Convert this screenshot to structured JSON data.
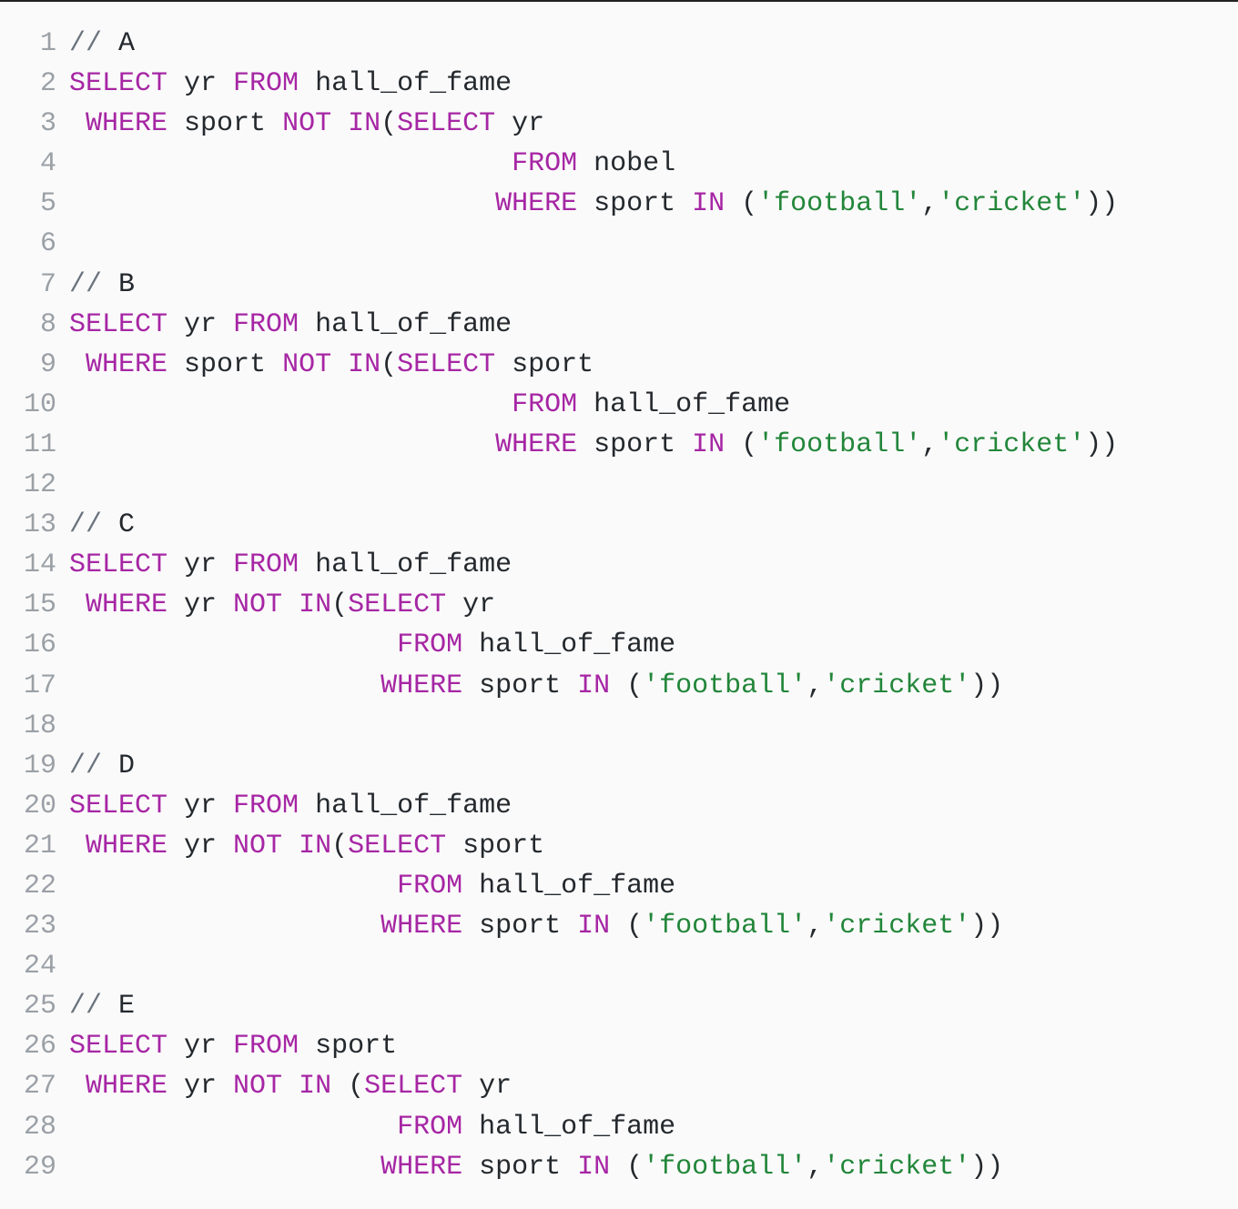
{
  "code": {
    "lines": [
      {
        "n": "1",
        "tokens": [
          {
            "c": "cm",
            "t": "// "
          },
          {
            "c": "id",
            "t": "A"
          }
        ]
      },
      {
        "n": "2",
        "tokens": [
          {
            "c": "kw",
            "t": "SELECT"
          },
          {
            "c": "id",
            "t": " yr "
          },
          {
            "c": "kw",
            "t": "FROM"
          },
          {
            "c": "id",
            "t": " hall_of_fame"
          }
        ]
      },
      {
        "n": "3",
        "tokens": [
          {
            "c": "id",
            "t": " "
          },
          {
            "c": "kw",
            "t": "WHERE"
          },
          {
            "c": "id",
            "t": " sport "
          },
          {
            "c": "kw",
            "t": "NOT"
          },
          {
            "c": "id",
            "t": " "
          },
          {
            "c": "kw",
            "t": "IN"
          },
          {
            "c": "pn",
            "t": "("
          },
          {
            "c": "kw",
            "t": "SELECT"
          },
          {
            "c": "id",
            "t": " yr"
          }
        ]
      },
      {
        "n": "4",
        "tokens": [
          {
            "c": "id",
            "t": "                           "
          },
          {
            "c": "kw",
            "t": "FROM"
          },
          {
            "c": "id",
            "t": " nobel"
          }
        ]
      },
      {
        "n": "5",
        "tokens": [
          {
            "c": "id",
            "t": "                          "
          },
          {
            "c": "kw",
            "t": "WHERE"
          },
          {
            "c": "id",
            "t": " sport "
          },
          {
            "c": "kw",
            "t": "IN"
          },
          {
            "c": "id",
            "t": " "
          },
          {
            "c": "pn",
            "t": "("
          },
          {
            "c": "str",
            "t": "'football'"
          },
          {
            "c": "pn",
            "t": ","
          },
          {
            "c": "str",
            "t": "'cricket'"
          },
          {
            "c": "pn",
            "t": "))"
          }
        ]
      },
      {
        "n": "6",
        "tokens": []
      },
      {
        "n": "7",
        "tokens": [
          {
            "c": "cm",
            "t": "// "
          },
          {
            "c": "id",
            "t": "B"
          }
        ]
      },
      {
        "n": "8",
        "tokens": [
          {
            "c": "kw",
            "t": "SELECT"
          },
          {
            "c": "id",
            "t": " yr "
          },
          {
            "c": "kw",
            "t": "FROM"
          },
          {
            "c": "id",
            "t": " hall_of_fame"
          }
        ]
      },
      {
        "n": "9",
        "tokens": [
          {
            "c": "id",
            "t": " "
          },
          {
            "c": "kw",
            "t": "WHERE"
          },
          {
            "c": "id",
            "t": " sport "
          },
          {
            "c": "kw",
            "t": "NOT"
          },
          {
            "c": "id",
            "t": " "
          },
          {
            "c": "kw",
            "t": "IN"
          },
          {
            "c": "pn",
            "t": "("
          },
          {
            "c": "kw",
            "t": "SELECT"
          },
          {
            "c": "id",
            "t": " sport"
          }
        ]
      },
      {
        "n": "10",
        "tokens": [
          {
            "c": "id",
            "t": "                           "
          },
          {
            "c": "kw",
            "t": "FROM"
          },
          {
            "c": "id",
            "t": " hall_of_fame"
          }
        ]
      },
      {
        "n": "11",
        "tokens": [
          {
            "c": "id",
            "t": "                          "
          },
          {
            "c": "kw",
            "t": "WHERE"
          },
          {
            "c": "id",
            "t": " sport "
          },
          {
            "c": "kw",
            "t": "IN"
          },
          {
            "c": "id",
            "t": " "
          },
          {
            "c": "pn",
            "t": "("
          },
          {
            "c": "str",
            "t": "'football'"
          },
          {
            "c": "pn",
            "t": ","
          },
          {
            "c": "str",
            "t": "'cricket'"
          },
          {
            "c": "pn",
            "t": "))"
          }
        ]
      },
      {
        "n": "12",
        "tokens": []
      },
      {
        "n": "13",
        "tokens": [
          {
            "c": "cm",
            "t": "// "
          },
          {
            "c": "id",
            "t": "C"
          }
        ]
      },
      {
        "n": "14",
        "tokens": [
          {
            "c": "kw",
            "t": "SELECT"
          },
          {
            "c": "id",
            "t": " yr "
          },
          {
            "c": "kw",
            "t": "FROM"
          },
          {
            "c": "id",
            "t": " hall_of_fame"
          }
        ]
      },
      {
        "n": "15",
        "tokens": [
          {
            "c": "id",
            "t": " "
          },
          {
            "c": "kw",
            "t": "WHERE"
          },
          {
            "c": "id",
            "t": " yr "
          },
          {
            "c": "kw",
            "t": "NOT"
          },
          {
            "c": "id",
            "t": " "
          },
          {
            "c": "kw",
            "t": "IN"
          },
          {
            "c": "pn",
            "t": "("
          },
          {
            "c": "kw",
            "t": "SELECT"
          },
          {
            "c": "id",
            "t": " yr"
          }
        ]
      },
      {
        "n": "16",
        "tokens": [
          {
            "c": "id",
            "t": "                    "
          },
          {
            "c": "kw",
            "t": "FROM"
          },
          {
            "c": "id",
            "t": " hall_of_fame"
          }
        ]
      },
      {
        "n": "17",
        "tokens": [
          {
            "c": "id",
            "t": "                   "
          },
          {
            "c": "kw",
            "t": "WHERE"
          },
          {
            "c": "id",
            "t": " sport "
          },
          {
            "c": "kw",
            "t": "IN"
          },
          {
            "c": "id",
            "t": " "
          },
          {
            "c": "pn",
            "t": "("
          },
          {
            "c": "str",
            "t": "'football'"
          },
          {
            "c": "pn",
            "t": ","
          },
          {
            "c": "str",
            "t": "'cricket'"
          },
          {
            "c": "pn",
            "t": "))"
          }
        ]
      },
      {
        "n": "18",
        "tokens": []
      },
      {
        "n": "19",
        "tokens": [
          {
            "c": "cm",
            "t": "// "
          },
          {
            "c": "id",
            "t": "D"
          }
        ]
      },
      {
        "n": "20",
        "tokens": [
          {
            "c": "kw",
            "t": "SELECT"
          },
          {
            "c": "id",
            "t": " yr "
          },
          {
            "c": "kw",
            "t": "FROM"
          },
          {
            "c": "id",
            "t": " hall_of_fame"
          }
        ]
      },
      {
        "n": "21",
        "tokens": [
          {
            "c": "id",
            "t": " "
          },
          {
            "c": "kw",
            "t": "WHERE"
          },
          {
            "c": "id",
            "t": " yr "
          },
          {
            "c": "kw",
            "t": "NOT"
          },
          {
            "c": "id",
            "t": " "
          },
          {
            "c": "kw",
            "t": "IN"
          },
          {
            "c": "pn",
            "t": "("
          },
          {
            "c": "kw",
            "t": "SELECT"
          },
          {
            "c": "id",
            "t": " sport"
          }
        ]
      },
      {
        "n": "22",
        "tokens": [
          {
            "c": "id",
            "t": "                    "
          },
          {
            "c": "kw",
            "t": "FROM"
          },
          {
            "c": "id",
            "t": " hall_of_fame"
          }
        ]
      },
      {
        "n": "23",
        "tokens": [
          {
            "c": "id",
            "t": "                   "
          },
          {
            "c": "kw",
            "t": "WHERE"
          },
          {
            "c": "id",
            "t": " sport "
          },
          {
            "c": "kw",
            "t": "IN"
          },
          {
            "c": "id",
            "t": " "
          },
          {
            "c": "pn",
            "t": "("
          },
          {
            "c": "str",
            "t": "'football'"
          },
          {
            "c": "pn",
            "t": ","
          },
          {
            "c": "str",
            "t": "'cricket'"
          },
          {
            "c": "pn",
            "t": "))"
          }
        ]
      },
      {
        "n": "24",
        "tokens": []
      },
      {
        "n": "25",
        "tokens": [
          {
            "c": "cm",
            "t": "// "
          },
          {
            "c": "id",
            "t": "E"
          }
        ]
      },
      {
        "n": "26",
        "tokens": [
          {
            "c": "kw",
            "t": "SELECT"
          },
          {
            "c": "id",
            "t": " yr "
          },
          {
            "c": "kw",
            "t": "FROM"
          },
          {
            "c": "id",
            "t": " sport"
          }
        ]
      },
      {
        "n": "27",
        "tokens": [
          {
            "c": "id",
            "t": " "
          },
          {
            "c": "kw",
            "t": "WHERE"
          },
          {
            "c": "id",
            "t": " yr "
          },
          {
            "c": "kw",
            "t": "NOT"
          },
          {
            "c": "id",
            "t": " "
          },
          {
            "c": "kw",
            "t": "IN"
          },
          {
            "c": "id",
            "t": " "
          },
          {
            "c": "pn",
            "t": "("
          },
          {
            "c": "kw",
            "t": "SELECT"
          },
          {
            "c": "id",
            "t": " yr"
          }
        ]
      },
      {
        "n": "28",
        "tokens": [
          {
            "c": "id",
            "t": "                    "
          },
          {
            "c": "kw",
            "t": "FROM"
          },
          {
            "c": "id",
            "t": " hall_of_fame"
          }
        ]
      },
      {
        "n": "29",
        "tokens": [
          {
            "c": "id",
            "t": "                   "
          },
          {
            "c": "kw",
            "t": "WHERE"
          },
          {
            "c": "id",
            "t": " sport "
          },
          {
            "c": "kw",
            "t": "IN"
          },
          {
            "c": "id",
            "t": " "
          },
          {
            "c": "pn",
            "t": "("
          },
          {
            "c": "str",
            "t": "'football'"
          },
          {
            "c": "pn",
            "t": ","
          },
          {
            "c": "str",
            "t": "'cricket'"
          },
          {
            "c": "pn",
            "t": "))"
          }
        ]
      }
    ]
  }
}
